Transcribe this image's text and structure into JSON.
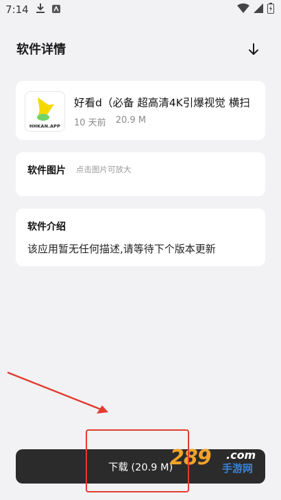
{
  "status_bar": {
    "time": "7:14"
  },
  "header": {
    "title": "软件详情"
  },
  "app": {
    "logo_text": "HHKAN.APP",
    "name": "好看d（必备 超高清4K引爆视觉 横扫",
    "updated": "10 天前",
    "size": "20.9 M"
  },
  "screenshots": {
    "label": "软件图片",
    "hint": "点击图片可放大"
  },
  "intro": {
    "label": "软件介绍",
    "text": "该应用暂无任何描述,请等待下个版本更新"
  },
  "download": {
    "label": "下载 (20.9 M)"
  },
  "watermark": {
    "big": "289",
    "com": ".com",
    "small": "手游网"
  },
  "colors": {
    "annotation": "#e23c30",
    "download_bg": "#2b2b2b",
    "logo_yellow": "#f5d800",
    "logo_green": "#6fd36c"
  }
}
